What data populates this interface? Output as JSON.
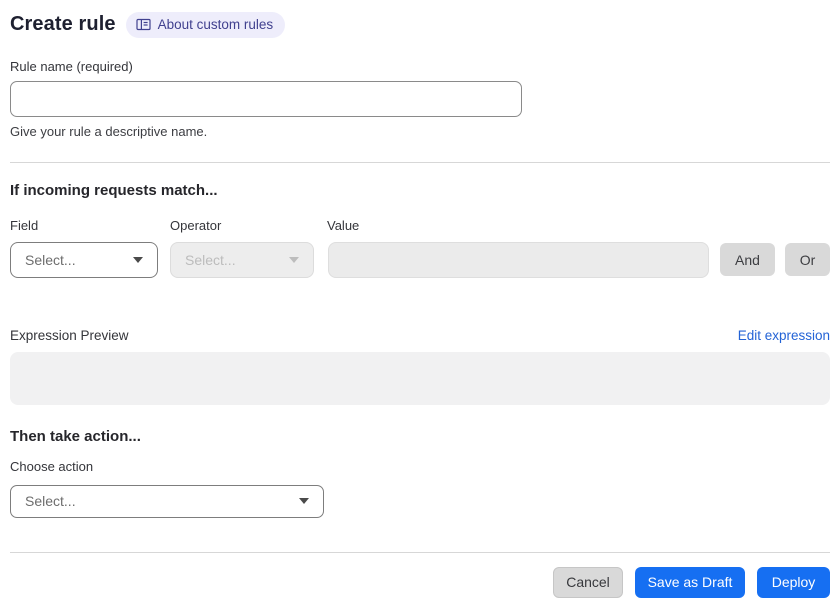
{
  "header": {
    "title": "Create rule",
    "badge": {
      "label": "About custom rules",
      "icon": "book-icon"
    }
  },
  "rule_name": {
    "label": "Rule name (required)",
    "value": "",
    "helper": "Give your rule a descriptive name."
  },
  "match_section": {
    "heading": "If incoming requests match...",
    "field": {
      "label": "Field",
      "selected": "Select..."
    },
    "operator": {
      "label": "Operator",
      "selected": "Select...",
      "state": "disabled"
    },
    "value": {
      "label": "Value",
      "value": "",
      "state": "disabled"
    },
    "and_button": "And",
    "or_button": "Or"
  },
  "expression": {
    "label": "Expression Preview",
    "edit_link": "Edit expression",
    "content": ""
  },
  "action_section": {
    "heading": "Then take action...",
    "choose_label": "Choose action",
    "selected": "Select..."
  },
  "footer": {
    "cancel_label": "Cancel",
    "save_draft_label": "Save as Draft",
    "deploy_label": "Deploy"
  },
  "colors": {
    "primary_blue": "#166ff2",
    "link_blue": "#2363d6",
    "badge_bg": "#eeedfb",
    "badge_text": "#41418f",
    "disabled_fill": "#ededed",
    "chip_gray": "#d9d9d9"
  }
}
